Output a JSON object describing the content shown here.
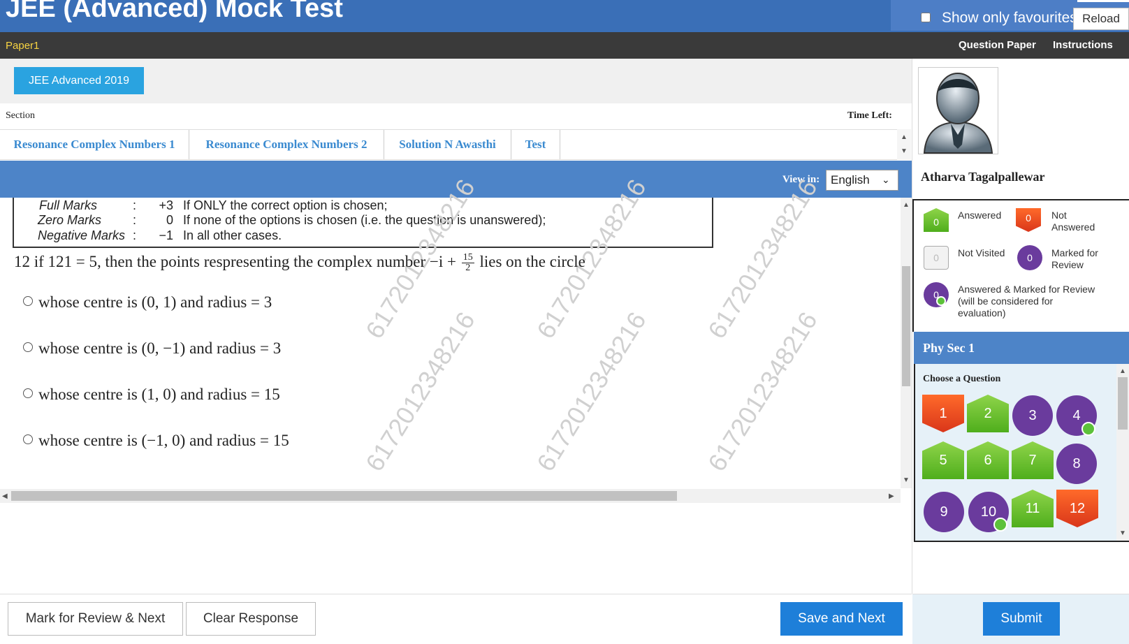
{
  "header": {
    "title": "JEE (Advanced) Mock Test",
    "favourites_label": "Show only favourites",
    "reload_label": "Reload"
  },
  "subheader": {
    "paper": "Paper1",
    "question_paper": "Question Paper",
    "instructions": "Instructions"
  },
  "exam": {
    "name": "JEE Advanced 2019",
    "section_label": "Section",
    "time_left_label": "Time Left:",
    "sections": [
      "Resonance Complex Numbers 1",
      "Resonance Complex Numbers 2",
      "Solution N Awasthi",
      "Test"
    ],
    "view_in_label": "View in:",
    "language": "English"
  },
  "marking": {
    "rows": [
      {
        "label": "Full Marks",
        "colon": ":",
        "value": "+3",
        "desc": "If ONLY the correct option is chosen;"
      },
      {
        "label": "Zero Marks",
        "colon": ":",
        "value": "0",
        "desc": "If none of the options is chosen (i.e. the question is unanswered);"
      },
      {
        "label": "Negative Marks",
        "colon": ":",
        "value": "−1",
        "desc": "In all other cases."
      }
    ]
  },
  "question": {
    "prefix": "12 if 121 = 5, then the points respresenting the complex number −i +",
    "frac_num": "15",
    "frac_den": "2",
    "suffix": "lies on the circle",
    "options": [
      "whose centre is (0, 1) and radius = 3",
      "whose centre is (0, −1) and radius = 3",
      "whose centre is (1, 0) and radius = 15",
      "whose centre is (−1, 0) and radius = 15"
    ],
    "watermark": "6172012348216"
  },
  "footer": {
    "mark_review": "Mark for Review & Next",
    "clear": "Clear Response",
    "save_next": "Save and Next",
    "submit": "Submit"
  },
  "candidate": {
    "name": "Atharva Tagalpallewar"
  },
  "legend": {
    "answered": {
      "count": "0",
      "label": "Answered"
    },
    "not_answered": {
      "count": "0",
      "label_1": "Not",
      "label_2": "Answered"
    },
    "not_visited": {
      "count": "0",
      "label": "Not Visited"
    },
    "marked": {
      "count": "0",
      "label_1": "Marked for",
      "label_2": "Review"
    },
    "answered_marked": {
      "count": "0",
      "label_1": "Answered & Marked for Review",
      "label_2": "(will be considered for",
      "label_3": "evaluation)"
    }
  },
  "palette": {
    "section": "Phy Sec 1",
    "choose_label": "Choose a Question",
    "questions": [
      {
        "n": "1",
        "status": "not-answered"
      },
      {
        "n": "2",
        "status": "answered"
      },
      {
        "n": "3",
        "status": "marked"
      },
      {
        "n": "4",
        "status": "answered-marked"
      },
      {
        "n": "5",
        "status": "answered"
      },
      {
        "n": "6",
        "status": "answered"
      },
      {
        "n": "7",
        "status": "answered"
      },
      {
        "n": "8",
        "status": "marked"
      },
      {
        "n": "9",
        "status": "marked"
      },
      {
        "n": "10",
        "status": "answered-marked"
      },
      {
        "n": "11",
        "status": "answered"
      },
      {
        "n": "12",
        "status": "not-answered"
      }
    ]
  },
  "colors": {
    "header_blue": "#3a6fb7",
    "accent_blue": "#1e7fd9",
    "answered_green": "#4fae1c",
    "not_answered_red": "#d9361a",
    "marked_purple": "#6a3b9d"
  }
}
